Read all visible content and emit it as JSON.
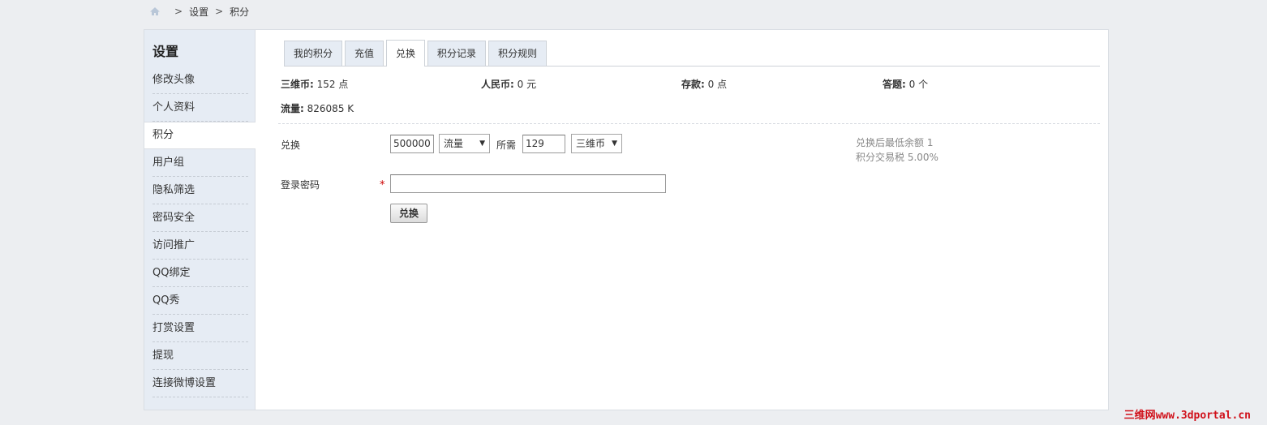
{
  "breadcrumb": {
    "items": [
      "设置",
      "积分"
    ],
    "separator": ">"
  },
  "sidebar": {
    "title": "设置",
    "items": [
      {
        "label": "修改头像",
        "active": false
      },
      {
        "label": "个人资料",
        "active": false
      },
      {
        "label": "积分",
        "active": true
      },
      {
        "label": "用户组",
        "active": false
      },
      {
        "label": "隐私筛选",
        "active": false
      },
      {
        "label": "密码安全",
        "active": false
      },
      {
        "label": "访问推广",
        "active": false
      },
      {
        "label": "QQ绑定",
        "active": false
      },
      {
        "label": "QQ秀",
        "active": false
      },
      {
        "label": "打赏设置",
        "active": false
      },
      {
        "label": "提现",
        "active": false
      },
      {
        "label": "连接微博设置",
        "active": false
      }
    ]
  },
  "tabs": [
    {
      "label": "我的积分",
      "active": false
    },
    {
      "label": "充值",
      "active": false
    },
    {
      "label": "兑换",
      "active": true
    },
    {
      "label": "积分记录",
      "active": false
    },
    {
      "label": "积分规则",
      "active": false
    }
  ],
  "stats": [
    {
      "label": "三维币:",
      "value": "152 点"
    },
    {
      "label": "人民币:",
      "value": "0 元"
    },
    {
      "label": "存款:",
      "value": "0 点"
    },
    {
      "label": "答题:",
      "value": "0 个"
    },
    {
      "label": "流量:",
      "value": "826085 K"
    }
  ],
  "exchange": {
    "label": "兑换",
    "amount_value": "500000",
    "from_select": "流量",
    "needed_label": "所需",
    "needed_value": "129",
    "to_select": "三维币",
    "hint_line1": "兑换后最低余额 1",
    "hint_line2": "积分交易税 5.00%"
  },
  "password": {
    "label": "登录密码",
    "required_mark": "*",
    "value": ""
  },
  "submit": {
    "label": "兑换"
  },
  "watermark": "三维网www.3dportal.cn",
  "colors": {
    "sidebar_bg": "#e6ecf4",
    "page_bg": "#eceef1",
    "required": "#cc0000",
    "watermark": "#d0101a"
  }
}
